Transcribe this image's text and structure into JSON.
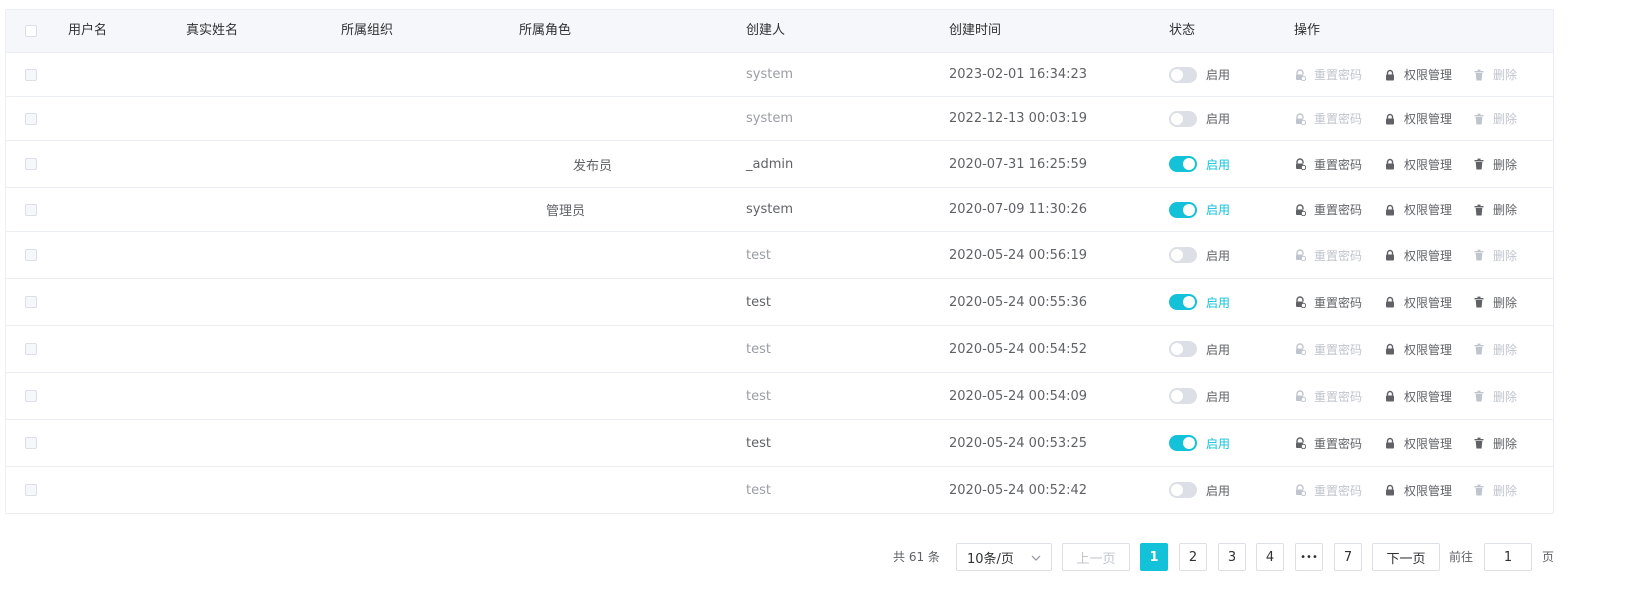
{
  "table": {
    "headers": [
      "用户名",
      "真实姓名",
      "所属组织",
      "所属角色",
      "创建人",
      "创建时间",
      "状态",
      "操作"
    ],
    "rows": [
      {
        "role": "",
        "creator": "system",
        "created": "2023-02-01 16:34:23",
        "enabled": false,
        "status_label": "启用",
        "reset": "重置密码",
        "perm": "权限管理",
        "del": "删除"
      },
      {
        "role": "",
        "creator": "system",
        "created": "2022-12-13 00:03:19",
        "enabled": false,
        "status_label": "启用",
        "reset": "重置密码",
        "perm": "权限管理",
        "del": "删除"
      },
      {
        "role": "发布员",
        "creator": "_admin",
        "created": "2020-07-31 16:25:59",
        "enabled": true,
        "status_label": "启用",
        "reset": "重置密码",
        "perm": "权限管理",
        "del": "删除"
      },
      {
        "role": "管理员",
        "creator": "system",
        "created": "2020-07-09 11:30:26",
        "enabled": true,
        "status_label": "启用",
        "reset": "重置密码",
        "perm": "权限管理",
        "del": "删除"
      },
      {
        "role": "",
        "creator": "test",
        "created": "2020-05-24 00:56:19",
        "enabled": false,
        "status_label": "启用",
        "reset": "重置密码",
        "perm": "权限管理",
        "del": "删除"
      },
      {
        "role": "",
        "creator": "test",
        "created": "2020-05-24 00:55:36",
        "enabled": true,
        "status_label": "启用",
        "reset": "重置密码",
        "perm": "权限管理",
        "del": "删除"
      },
      {
        "role": "",
        "creator": "test",
        "created": "2020-05-24 00:54:52",
        "enabled": false,
        "status_label": "启用",
        "reset": "重置密码",
        "perm": "权限管理",
        "del": "删除"
      },
      {
        "role": "",
        "creator": "test",
        "created": "2020-05-24 00:54:09",
        "enabled": false,
        "status_label": "启用",
        "reset": "重置密码",
        "perm": "权限管理",
        "del": "删除"
      },
      {
        "role": "",
        "creator": "test",
        "created": "2020-05-24 00:53:25",
        "enabled": true,
        "status_label": "启用",
        "reset": "重置密码",
        "perm": "权限管理",
        "del": "删除"
      },
      {
        "role": "",
        "creator": "test",
        "created": "2020-05-24 00:52:42",
        "enabled": false,
        "status_label": "启用",
        "reset": "重置密码",
        "perm": "权限管理",
        "del": "删除"
      }
    ]
  },
  "pagination": {
    "total_text": "共 61 条",
    "page_size": "10条/页",
    "prev": "上一页",
    "pages": [
      "1",
      "2",
      "3",
      "4",
      "•••",
      "7"
    ],
    "current": "1",
    "next": "下一页",
    "goto_prefix": "前往",
    "goto_value": "1",
    "goto_suffix": "页"
  },
  "colors": {
    "accent": "#13c2d9",
    "border": "#ebeef5",
    "header_bg": "#f5f7fa",
    "disabled_text": "#c0c4cc"
  },
  "icons": {
    "reset": "lock-reset-icon",
    "perm": "lock-icon",
    "del": "trash-icon",
    "dropdown": "chevron-down-icon"
  }
}
